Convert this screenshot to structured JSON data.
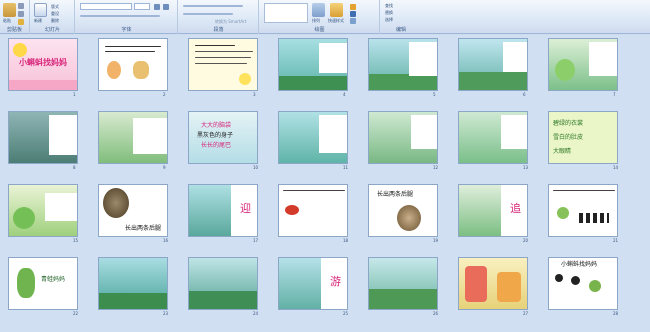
{
  "ribbon": {
    "paste_label": "粘贴",
    "cut_label": "剪切",
    "copy_label": "复制",
    "new_slide_label": "新建",
    "layout_label": "版式",
    "reset_label": "重设",
    "delete_label": "删除",
    "font_value": "",
    "size_value": "",
    "shapes_label": "形状",
    "arrange_label": "排列",
    "quick_styles_label": "快速样式",
    "find_label": "查找",
    "replace_label": "替换",
    "select_label": "选择",
    "smartart_label": "转换为 SmartArt",
    "group_clipboard": "剪贴板",
    "group_slides": "幻灯片",
    "group_font": "字体",
    "group_paragraph": "段落",
    "group_drawing": "绘图",
    "group_editing": "编辑"
  },
  "slides": [
    {
      "n": "1",
      "title": "小蝌蚪找妈妈"
    },
    {
      "n": "2"
    },
    {
      "n": "3"
    },
    {
      "n": "4"
    },
    {
      "n": "5"
    },
    {
      "n": "6"
    },
    {
      "n": "7"
    },
    {
      "n": "8"
    },
    {
      "n": "9"
    },
    {
      "n": "10",
      "lines": [
        "大大的脑袋",
        "黑灰色的身子",
        "长长的尾巴"
      ]
    },
    {
      "n": "11"
    },
    {
      "n": "12"
    },
    {
      "n": "13"
    },
    {
      "n": "14",
      "lines": [
        "碧绿的衣裳",
        "雪白的肚皮",
        "大眼睛"
      ]
    },
    {
      "n": "15"
    },
    {
      "n": "16",
      "caption": "长出两条后腿"
    },
    {
      "n": "17",
      "char": "迎"
    },
    {
      "n": "18"
    },
    {
      "n": "19",
      "caption": "长出两条后腿"
    },
    {
      "n": "20",
      "char": "追"
    },
    {
      "n": "21"
    },
    {
      "n": "22",
      "caption": "青蛙妈妈"
    },
    {
      "n": "23"
    },
    {
      "n": "24"
    },
    {
      "n": "25",
      "char": "游"
    },
    {
      "n": "26"
    },
    {
      "n": "27"
    },
    {
      "n": "28",
      "caption": "小蝌蚪找妈妈"
    }
  ]
}
